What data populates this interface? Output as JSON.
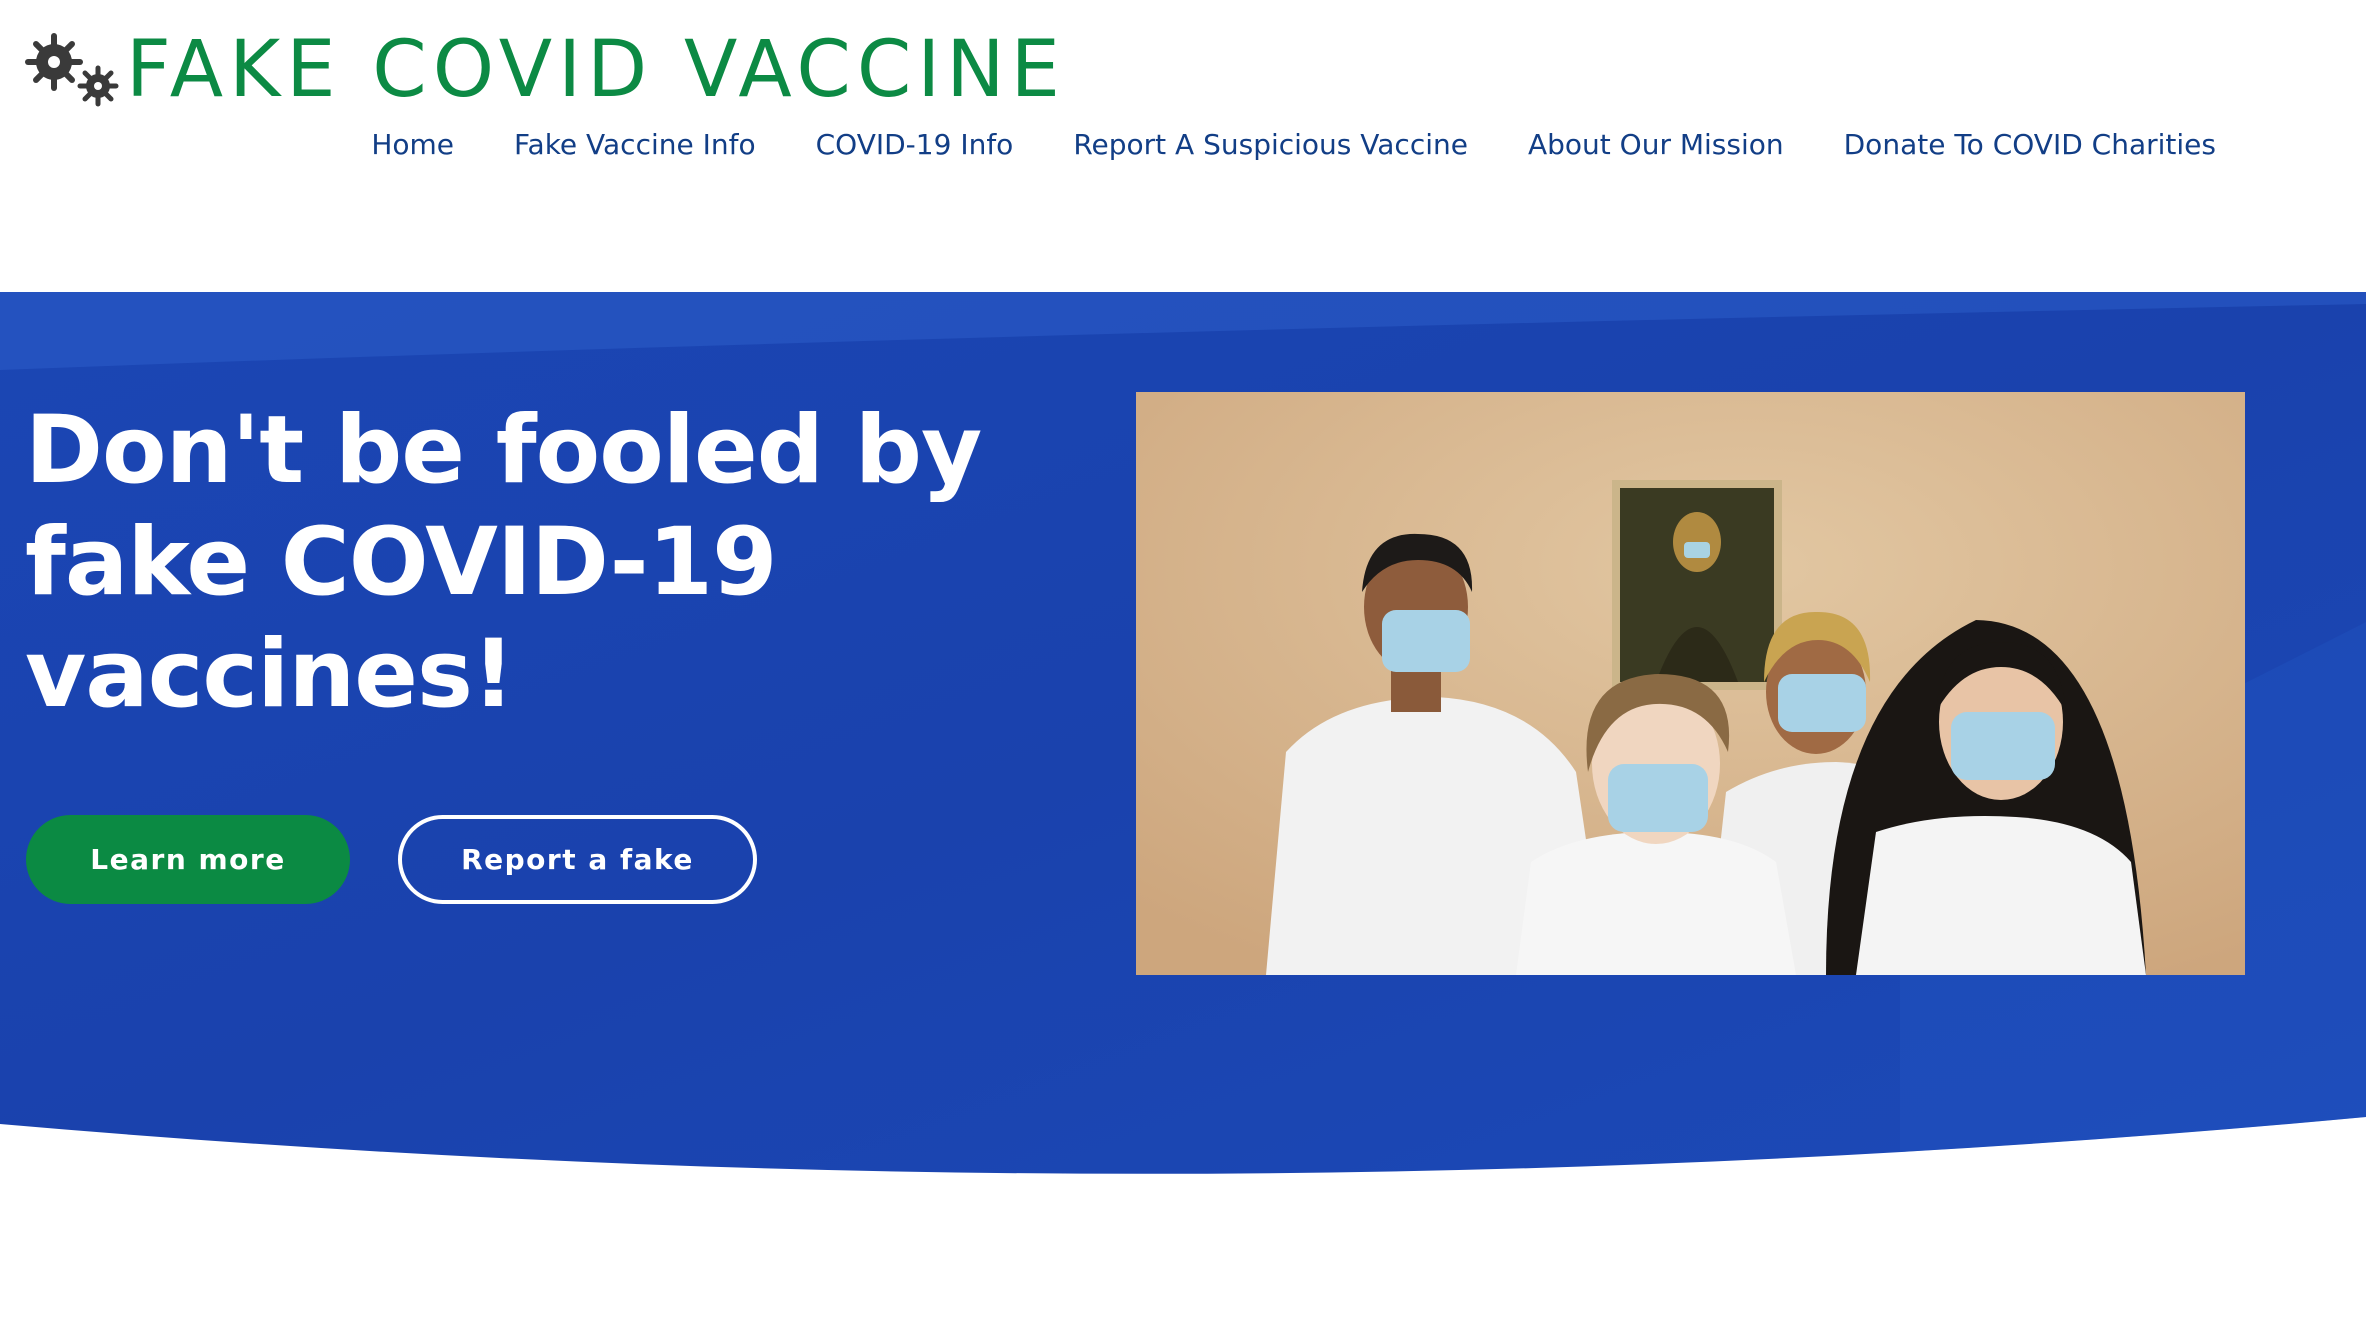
{
  "brand": {
    "name": "FAKE COVID VACCINE",
    "logo_icon": "virus-gears-icon",
    "color": "#0c8a44"
  },
  "nav": {
    "items": [
      {
        "label": "Home"
      },
      {
        "label": "Fake Vaccine Info"
      },
      {
        "label": "COVID-19 Info"
      },
      {
        "label": "Report A Suspicious Vaccine"
      },
      {
        "label": "About Our Mission"
      },
      {
        "label": "Donate To COVID Charities"
      }
    ],
    "color": "#123e86"
  },
  "hero": {
    "headline": "Don't be fooled by fake COVID-19 vaccines!",
    "primary_button": "Learn more",
    "secondary_button": "Report a fake",
    "background_color": "#1a45b4",
    "primary_button_color": "#0b8a43",
    "image": "photo-of-four-people-wearing-face-masks"
  }
}
